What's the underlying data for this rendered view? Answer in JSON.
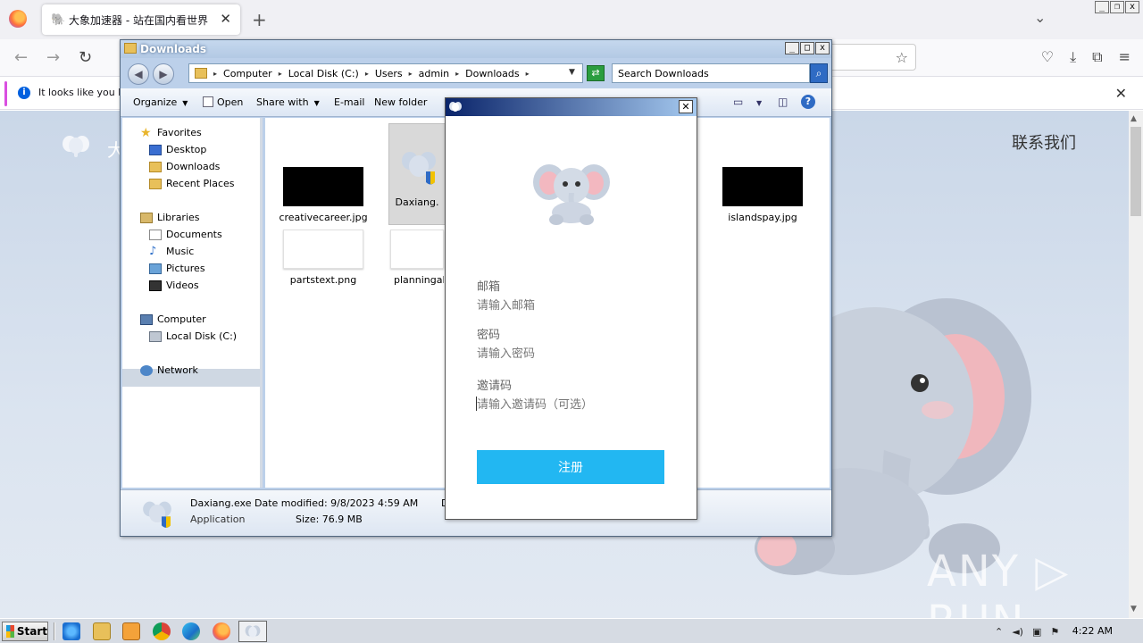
{
  "browser": {
    "tab_title": "大象加速器 - 站在国内看世界",
    "tab_close": "✕",
    "new_tab": "+",
    "list_tabs": "⌄",
    "notice_text": "It looks like you ha",
    "notice_icon_label": "i",
    "notice_close": "✕"
  },
  "webpage": {
    "brand_partial": "大",
    "contact": "联系我们",
    "watermark": "ANY ▷ RUN"
  },
  "explorer": {
    "title": "Downloads",
    "breadcrumbs": [
      "Computer",
      "Local Disk (C:)",
      "Users",
      "admin",
      "Downloads"
    ],
    "search_placeholder": "Search Downloads",
    "toolbar": {
      "organize": "Organize",
      "open": "Open",
      "share_with": "Share with",
      "email": "E-mail",
      "new_folder": "New folder"
    },
    "nav": {
      "favorites": "Favorites",
      "desktop": "Desktop",
      "downloads": "Downloads",
      "recent_places": "Recent Places",
      "libraries": "Libraries",
      "documents": "Documents",
      "music": "Music",
      "pictures": "Pictures",
      "videos": "Videos",
      "computer": "Computer",
      "local_disk": "Local Disk (C:)",
      "network": "Network"
    },
    "files": {
      "f1": "creativecareer.jpg",
      "f2": "Daxiang.",
      "f3": "islandspay.jpg",
      "f4": "partstext.png",
      "f5": "planningallc"
    },
    "details": {
      "name": "Daxiang.exe",
      "type": "Application",
      "modified": "Date modified: 9/8/2023 4:59 AM",
      "size": "Size: 76.9 MB",
      "extra": "D"
    }
  },
  "dialog": {
    "close": "✕",
    "email_label": "邮箱",
    "email_placeholder": "请输入邮箱",
    "password_label": "密码",
    "password_placeholder": "请输入密码",
    "invite_label": "邀请码",
    "invite_placeholder": "请输入邀请码（可选）",
    "submit": "注册"
  },
  "taskbar": {
    "start": "Start",
    "clock": "4:22 AM"
  },
  "colors": {
    "accent_button": "#22b7f2",
    "page_background": "#cad7e8",
    "dialog_title": "#0a246a"
  }
}
